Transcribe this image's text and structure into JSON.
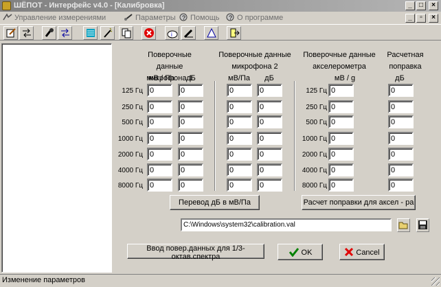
{
  "window": {
    "title": "ШЁПОТ - Интерфейс v4.0 - [Калибровка]",
    "controls": {
      "minimize": "_",
      "maximize": "□",
      "close": "×"
    }
  },
  "menu": {
    "items": [
      {
        "label": "Управление измерениями",
        "icon": "measure-control-icon"
      },
      {
        "label": "Параметры",
        "icon": "parameters-icon"
      },
      {
        "label": "Помощь",
        "icon": "help-icon"
      },
      {
        "label": "О программе",
        "icon": "about-icon"
      }
    ],
    "mdi_controls": {
      "minimize": "_",
      "restore": "▫",
      "close": "×"
    }
  },
  "toolbar": {
    "icons": [
      "edit-icon",
      "swap-icon",
      "mic-icon",
      "transfer-icon",
      "list-icon",
      "wand-icon",
      "copy-icon",
      "stop-icon",
      "info-icon",
      "pencil-icon",
      "triangle-icon",
      "exit-icon"
    ]
  },
  "calibration": {
    "freq_labels": [
      "125 Гц",
      "250 Гц",
      "500 Гц",
      "1000 Гц",
      "2000 Гц",
      "4000 Гц",
      "8000 Гц"
    ],
    "mic1": {
      "header": "Поверочные данные микрофона 1",
      "unit_mv": "мВ / Па",
      "unit_db": "дБ",
      "mv": [
        "0",
        "0",
        "0",
        "0",
        "0",
        "0",
        "0"
      ],
      "db": [
        "0",
        "0",
        "0",
        "0",
        "0",
        "0",
        "0"
      ]
    },
    "mic2": {
      "header": "Поверочные данные микрофона 2",
      "unit_mv": "мВ/Па",
      "unit_db": "дБ",
      "mv": [
        "0",
        "0",
        "0",
        "0",
        "0",
        "0",
        "0"
      ],
      "db": [
        "0",
        "0",
        "0",
        "0",
        "0",
        "0",
        "0"
      ]
    },
    "accel": {
      "header": "Поверочные данные акселерометра",
      "unit": "мВ / g",
      "values": [
        "0",
        "0",
        "0",
        "0",
        "0",
        "0",
        "0"
      ]
    },
    "correction": {
      "header": "Расчетная поправка",
      "unit": "дБ",
      "values": [
        "0",
        "0",
        "0",
        "0",
        "0",
        "0",
        "0"
      ]
    }
  },
  "buttons": {
    "convert": "Перевод дБ в мВ/Па",
    "calc_correction": "Расчет поправки для аксел - ра",
    "third_octave": "Ввод повер.данных для 1/3-октав.спектра",
    "ok": "OK",
    "cancel": "Cancel"
  },
  "file": {
    "path": "C:\\Windows\\system32\\calibration.val"
  },
  "status": {
    "text": "Изменение параметров"
  }
}
